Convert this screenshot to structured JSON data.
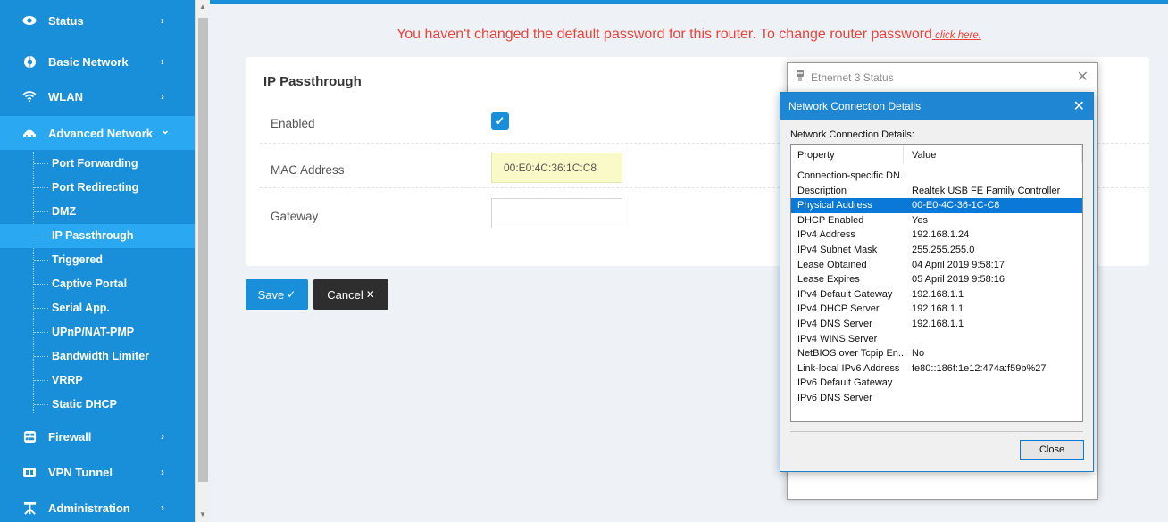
{
  "sidebar": {
    "items": [
      {
        "label": "Status",
        "icon": "eye-icon",
        "chevron": "›"
      },
      {
        "label": "Basic Network",
        "icon": "globe-icon",
        "chevron": "›"
      },
      {
        "label": "WLAN",
        "icon": "wifi-icon",
        "chevron": "›"
      },
      {
        "label": "Advanced Network",
        "icon": "network-icon",
        "chevron": "⌄"
      },
      {
        "label": "Firewall",
        "icon": "firewall-icon",
        "chevron": "›"
      },
      {
        "label": "VPN Tunnel",
        "icon": "vpn-icon",
        "chevron": "›"
      },
      {
        "label": "Administration",
        "icon": "admin-icon",
        "chevron": "›"
      }
    ],
    "subitems": [
      "Port Forwarding",
      "Port Redirecting",
      "DMZ",
      "IP Passthrough",
      "Triggered",
      "Captive Portal",
      "Serial App.",
      "UPnP/NAT-PMP",
      "Bandwidth Limiter",
      "VRRP",
      "Static DHCP"
    ],
    "active_subitem": "IP Passthrough"
  },
  "warning": {
    "text": "You haven't changed the default password for this router. To change router password",
    "link": " click here."
  },
  "panel": {
    "title": "IP Passthrough",
    "enabled_label": "Enabled",
    "enabled_checked": true,
    "mac_label": "MAC Address",
    "mac_value": "00:E0:4C:36:1C:C8",
    "gateway_label": "Gateway",
    "gateway_value": ""
  },
  "buttons": {
    "save": "Save",
    "save_glyph": "✓",
    "cancel": "Cancel",
    "cancel_glyph": "✕"
  },
  "eth_window": {
    "title": "Ethernet 3 Status",
    "close": "✕"
  },
  "ncd_window": {
    "title": "Network Connection Details",
    "close": "✕",
    "subtitle": "Network Connection Details:",
    "columns": {
      "property": "Property",
      "value": "Value"
    },
    "rows": [
      {
        "property": "Connection-specific DN...",
        "value": ""
      },
      {
        "property": "Description",
        "value": "Realtek USB FE Family Controller"
      },
      {
        "property": "Physical Address",
        "value": "00-E0-4C-36-1C-C8"
      },
      {
        "property": "DHCP Enabled",
        "value": "Yes"
      },
      {
        "property": "IPv4 Address",
        "value": "192.168.1.24"
      },
      {
        "property": "IPv4 Subnet Mask",
        "value": "255.255.255.0"
      },
      {
        "property": "Lease Obtained",
        "value": "04 April 2019 9:58:17"
      },
      {
        "property": "Lease Expires",
        "value": "05 April 2019 9:58:16"
      },
      {
        "property": "IPv4 Default Gateway",
        "value": "192.168.1.1"
      },
      {
        "property": "IPv4 DHCP Server",
        "value": "192.168.1.1"
      },
      {
        "property": "IPv4 DNS Server",
        "value": "192.168.1.1"
      },
      {
        "property": "IPv4 WINS Server",
        "value": ""
      },
      {
        "property": "NetBIOS over Tcpip En...",
        "value": "No"
      },
      {
        "property": "Link-local IPv6 Address",
        "value": "fe80::186f:1e12:474a:f59b%27"
      },
      {
        "property": "IPv6 Default Gateway",
        "value": ""
      },
      {
        "property": "IPv6 DNS Server",
        "value": ""
      }
    ],
    "selected_row": "Physical Address",
    "close_button": "Close"
  },
  "colors": {
    "sidebar": "#1a8fd9",
    "sidebar_active": "#2aa8f2",
    "warning": "#e8443a",
    "dialog_titlebar": "#1f86d3",
    "selection": "#0a78d7"
  }
}
